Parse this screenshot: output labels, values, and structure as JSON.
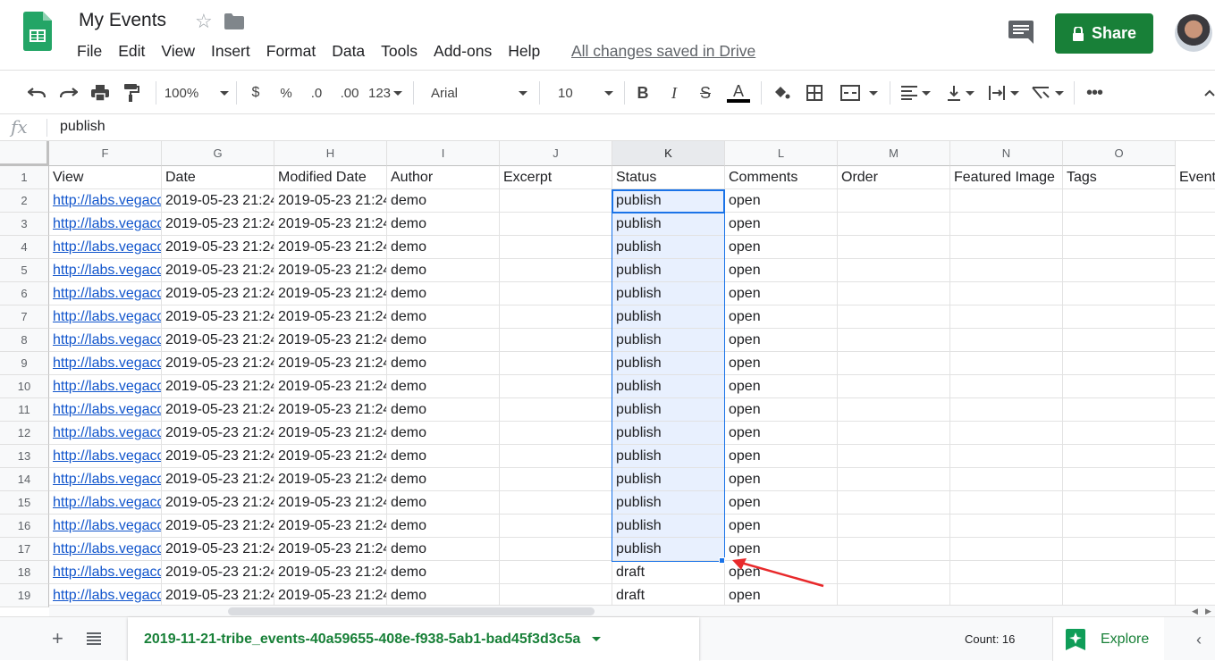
{
  "header": {
    "doc_title": "My Events",
    "menu": [
      "File",
      "Edit",
      "View",
      "Insert",
      "Format",
      "Data",
      "Tools",
      "Add-ons",
      "Help"
    ],
    "save_status": "All changes saved in Drive",
    "share_label": "Share"
  },
  "toolbar": {
    "zoom": "100%",
    "currency": "$",
    "percent": "%",
    "dec_decrease": ".0",
    "dec_increase": ".00",
    "more_formats": "123",
    "font": "Arial",
    "font_size": "10",
    "bold": "B",
    "italic": "I",
    "strike": "S",
    "text_color": "A"
  },
  "formula_bar": {
    "fx": "fx",
    "value": "publish"
  },
  "grid": {
    "columns": [
      "F",
      "G",
      "H",
      "I",
      "J",
      "K",
      "L",
      "M",
      "N",
      "O"
    ],
    "header_row": [
      "View",
      "Date",
      "Modified Date",
      "Author",
      "Excerpt",
      "Status",
      "Comments",
      "Order",
      "Featured Image",
      "Tags",
      "Event"
    ],
    "row_numbers": [
      "1",
      "2",
      "3",
      "4",
      "5",
      "6",
      "7",
      "8",
      "9",
      "10",
      "11",
      "12",
      "13",
      "14",
      "15",
      "16",
      "17",
      "18",
      "19"
    ],
    "view_text": "http://labs.vegaco",
    "date_text": "2019-05-23 21:24",
    "modified_text": "2019-05-23 21:24",
    "author_text": "demo",
    "statuses": [
      "publish",
      "publish",
      "publish",
      "publish",
      "publish",
      "publish",
      "publish",
      "publish",
      "publish",
      "publish",
      "publish",
      "publish",
      "publish",
      "publish",
      "publish",
      "publish",
      "draft",
      "draft"
    ],
    "comments_text": "open"
  },
  "bottom": {
    "sheet_name": "2019-11-21-tribe_events-40a59655-408e-f938-5ab1-bad45f3d3c5a",
    "count": "Count: 16",
    "explore": "Explore"
  },
  "colors": {
    "brand_green": "#188038",
    "selection_blue": "#1a73e8",
    "selection_fill": "#e8f0fe",
    "annotation_red": "#e8292b"
  }
}
